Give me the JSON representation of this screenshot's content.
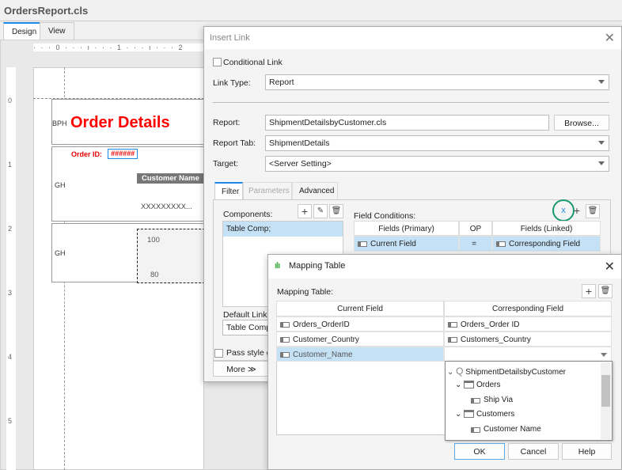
{
  "window": {
    "title": "OrdersReport.cls",
    "tabs": [
      "Design",
      "View"
    ]
  },
  "designer": {
    "ruler_top": "· · · 0 · · · ı · · · 1 · · · ı · · · 2",
    "ruler_left": [
      "0",
      "1",
      "2",
      "3",
      "4",
      "5"
    ],
    "bands": [
      {
        "label": "BPH"
      },
      {
        "label": "GH"
      },
      {
        "label": "GH"
      }
    ],
    "title_text": "Order Details",
    "order_id_label": "Order ID:",
    "order_id_value": "######",
    "customer_name_header": "Customer Name",
    "customer_name_value": "XXXXXXXXX...",
    "chart_ticks": [
      "100",
      "80"
    ]
  },
  "insert_link": {
    "title": "Insert Link",
    "conditional_link": {
      "label": "Conditional Link",
      "checked": false
    },
    "link_type": {
      "label": "Link Type:",
      "value": "Report"
    },
    "report": {
      "label": "Report:",
      "value": "ShipmentDetailsbyCustomer.cls",
      "browse": "Browse..."
    },
    "report_tab": {
      "label": "Report Tab:",
      "value": "ShipmentDetails"
    },
    "target": {
      "label": "Target:",
      "value": "<Server Setting>"
    },
    "tabs": [
      {
        "label": "Filter",
        "active": true
      },
      {
        "label": "Parameters",
        "disabled": true
      },
      {
        "label": "Advanced"
      }
    ],
    "components": {
      "label": "Components:",
      "items": [
        "Table Comp;"
      ]
    },
    "default_linked": {
      "label": "Default Linked",
      "value": "Table Comp"
    },
    "field_conditions": {
      "label": "Field Conditions:",
      "clear_button": "x",
      "columns": [
        "Fields (Primary)",
        "OP",
        "Fields (Linked)"
      ],
      "rows": [
        [
          "Current Field",
          "=",
          "Corresponding Field"
        ]
      ]
    },
    "pass_style": {
      "label": "Pass style group",
      "checked": false
    },
    "more": "More ≫",
    "highlight_color": "#1a9a6c"
  },
  "mapping_table": {
    "title": "Mapping Table",
    "label": "Mapping Table:",
    "columns": [
      "Current Field",
      "Corresponding Field"
    ],
    "rows": [
      [
        "Orders_OrderID",
        "Orders_Order ID"
      ],
      [
        "Customer_Country",
        "Customers_Country"
      ],
      [
        "Customer_Name",
        ""
      ]
    ],
    "tree": [
      {
        "label": "ShipmentDetailsbyCustomer",
        "type": "query"
      },
      {
        "label": "Orders",
        "type": "table"
      },
      {
        "label": "Ship Via",
        "type": "field"
      },
      {
        "label": "Customers",
        "type": "table"
      },
      {
        "label": "Customer Name",
        "type": "field"
      }
    ],
    "buttons": {
      "ok": "OK",
      "cancel": "Cancel",
      "help": "Help"
    }
  }
}
